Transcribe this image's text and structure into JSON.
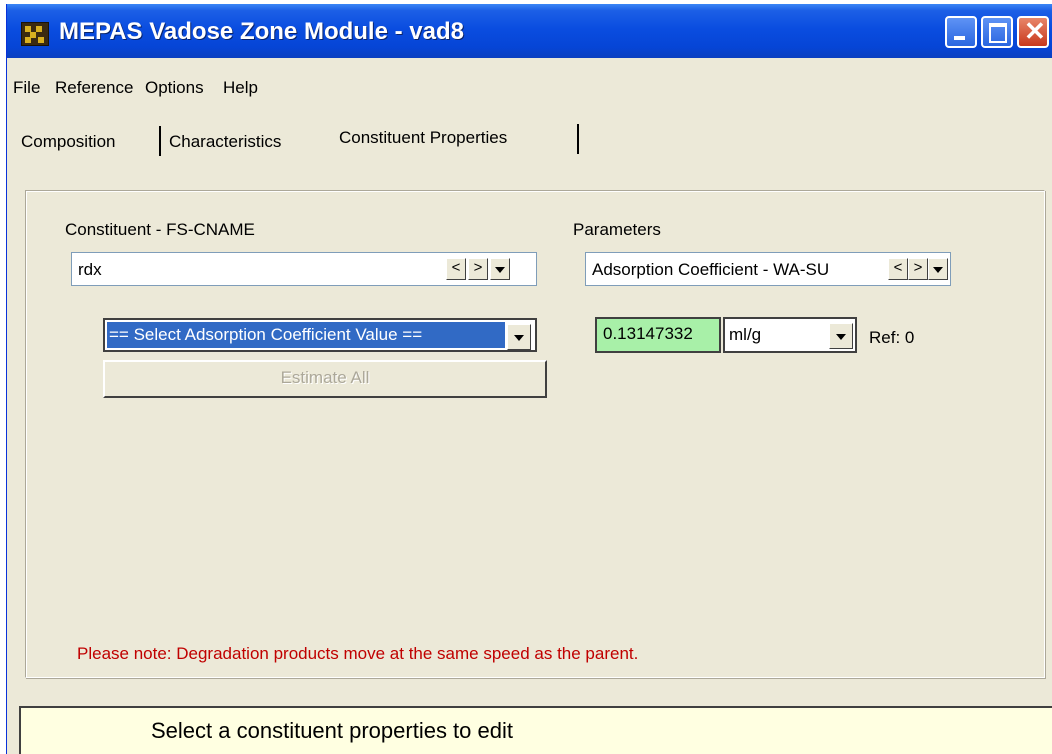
{
  "window": {
    "title": "MEPAS Vadose Zone Module - vad8"
  },
  "menubar": {
    "items": [
      "File",
      "Reference",
      "Options",
      "Help"
    ]
  },
  "tabs": [
    "Composition",
    "Characteristics",
    "Constituent Properties"
  ],
  "constituent": {
    "label": "Constituent - FS-CNAME",
    "value": "rdx",
    "prev_glyph": "<",
    "next_glyph": ">"
  },
  "parameters": {
    "label": "Parameters",
    "value": "Adsorption Coefficient - WA-SU",
    "prev_glyph": "<",
    "next_glyph": ">"
  },
  "adsorption_select": {
    "value": "== Select Adsorption Coefficient Value =="
  },
  "estimate_button": {
    "label": "Estimate All",
    "enabled": false
  },
  "value_field": {
    "value": "0.13147332",
    "color": "#a8f0a8"
  },
  "unit_select": {
    "value": "ml/g"
  },
  "reference": {
    "label": "Ref: 0"
  },
  "note": {
    "text": "Please note: Degradation products move at the same speed as the parent.",
    "color": "#c00000"
  },
  "statusbar": {
    "text": "Select a constituent properties to edit"
  },
  "colors": {
    "titlebar": "#0a4de0",
    "window_bg": "#ece9d8",
    "selection": "#316ac5",
    "status_bg": "#ffffe1"
  }
}
